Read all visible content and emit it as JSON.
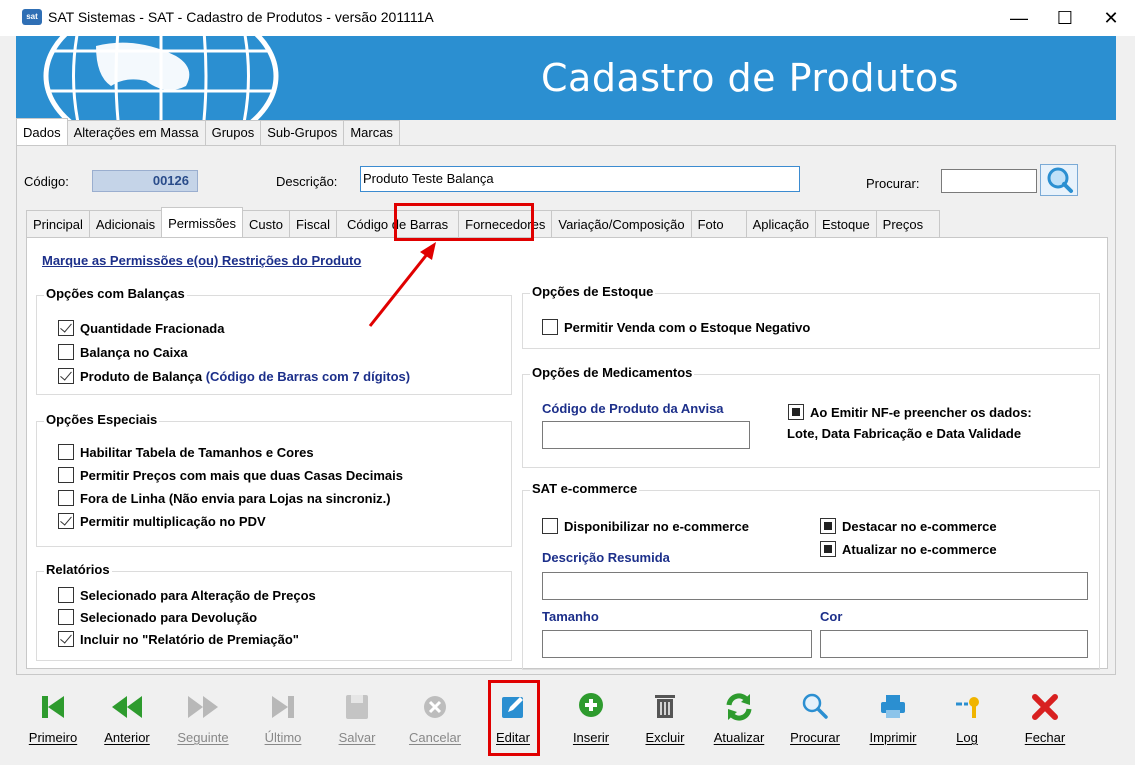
{
  "window": {
    "title": "SAT Sistemas - SAT - Cadastro de Produtos - versão 201111A",
    "icon_label": "sat",
    "minimize": "—",
    "maximize": "☐",
    "close": "✕"
  },
  "banner": {
    "title": "Cadastro de Produtos"
  },
  "top_tabs": [
    "Dados",
    "Alterações em Massa",
    "Grupos",
    "Sub-Grupos",
    "Marcas"
  ],
  "header": {
    "code_label": "Código:",
    "code_value": "00126",
    "description_label": "Descrição:",
    "description_value": "Produto Teste Balança",
    "search_label": "Procurar:",
    "search_value": ""
  },
  "sub_tabs": [
    "Principal",
    "Adicionais",
    "Permissões",
    "Custo",
    "Fiscal",
    "Código de Barras",
    "Fornecedores",
    "Variação/Composição",
    "Foto",
    "Aplicação",
    "Estoque",
    "Preços"
  ],
  "panel_heading": "Marque as Permissões e(ou) Restrições do Produto",
  "groups": {
    "balancas": {
      "title": "Opções com Balanças",
      "items": [
        {
          "label": "Quantidade Fracionada",
          "checked": true
        },
        {
          "label": "Balança no Caixa",
          "checked": false
        },
        {
          "label": "Produto de Balança",
          "note": "(Código de Barras com 7 dígitos)",
          "checked": true
        }
      ]
    },
    "especiais": {
      "title": "Opções Especiais",
      "items": [
        {
          "label": "Habilitar Tabela de Tamanhos e Cores",
          "checked": false
        },
        {
          "label": "Permitir Preços com mais que duas Casas Decimais",
          "checked": false
        },
        {
          "label": "Fora de Linha (Não envia para Lojas na sincroniz.)",
          "checked": false
        },
        {
          "label": "Permitir multiplicação no PDV",
          "checked": true
        }
      ]
    },
    "relatorios": {
      "title": "Relatórios",
      "items": [
        {
          "label": "Selecionado para Alteração de Preços",
          "checked": false
        },
        {
          "label": "Selecionado para Devolução",
          "checked": false
        },
        {
          "label": "Incluir no \"Relatório de Premiação\"",
          "checked": true
        }
      ]
    },
    "estoque": {
      "title": "Opções de Estoque",
      "items": [
        {
          "label": "Permitir Venda com o Estoque Negativo",
          "checked": false
        }
      ]
    },
    "medicamentos": {
      "title": "Opções de Medicamentos",
      "anvisa_label": "Código de Produto da Anvisa",
      "anvisa_value": "",
      "nfe_line1": "Ao Emitir NF-e preencher os dados:",
      "nfe_line2": "Lote, Data Fabricação e Data Validade"
    },
    "ecommerce": {
      "title": "SAT e-commerce",
      "disponibilizar": "Disponibilizar no e-commerce",
      "destacar": "Destacar no e-commerce",
      "atualizar": "Atualizar no e-commerce",
      "descricao_label": "Descrição Resumida",
      "tamanho_label": "Tamanho",
      "cor_label": "Cor"
    }
  },
  "toolbar": [
    {
      "label": "Primeiro",
      "icon": "first-icon",
      "enabled": true
    },
    {
      "label": "Anterior",
      "icon": "previous-icon",
      "enabled": true
    },
    {
      "label": "Seguinte",
      "icon": "next-icon",
      "enabled": false
    },
    {
      "label": "Último",
      "icon": "last-icon",
      "enabled": false
    },
    {
      "label": "Salvar",
      "icon": "save-icon",
      "enabled": false
    },
    {
      "label": "Cancelar",
      "icon": "cancel-icon",
      "enabled": false
    },
    {
      "label": "Editar",
      "icon": "edit-icon",
      "enabled": true
    },
    {
      "label": "Inserir",
      "icon": "insert-icon",
      "enabled": true
    },
    {
      "label": "Excluir",
      "icon": "trash-icon",
      "enabled": true
    },
    {
      "label": "Atualizar",
      "icon": "refresh-icon",
      "enabled": true
    },
    {
      "label": "Procurar",
      "icon": "search-icon",
      "enabled": true
    },
    {
      "label": "Imprimir",
      "icon": "printer-icon",
      "enabled": true
    },
    {
      "label": "Log",
      "icon": "key-icon",
      "enabled": true
    },
    {
      "label": "Fechar",
      "icon": "close-icon",
      "enabled": true
    }
  ],
  "colors": {
    "banner": "#2b8fd1",
    "label_blue": "#1c2f8a",
    "highlight_red": "#e00000",
    "nav_green": "#2e9b2e"
  }
}
